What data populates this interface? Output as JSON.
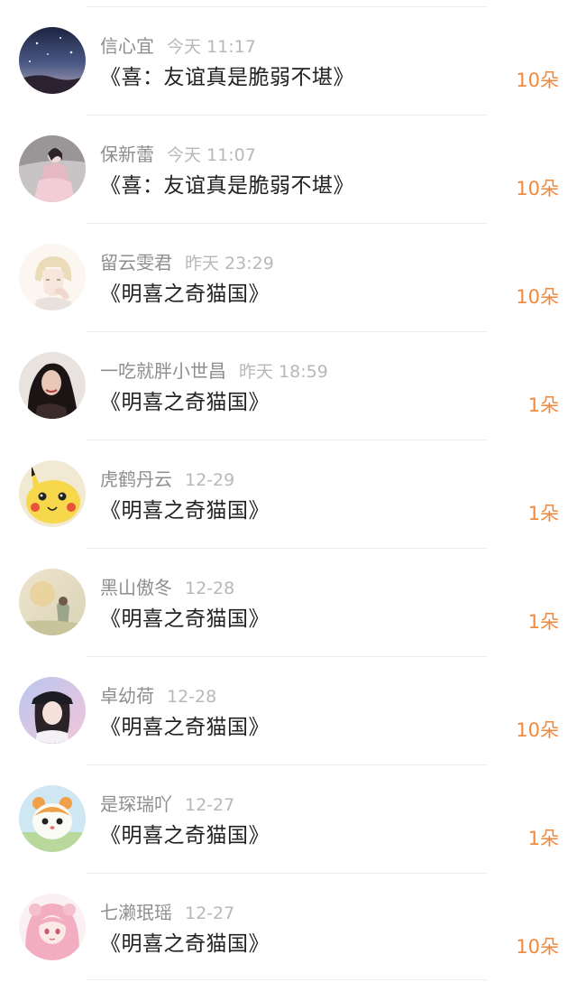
{
  "gifts": [
    {
      "name": "信心宜",
      "time": "今天 11:17",
      "title": "《喜：友谊真是脆弱不堪》",
      "count": "10朵",
      "avatar": "night-sky-avatar"
    },
    {
      "name": "保新蕾",
      "time": "今天 11:07",
      "title": "《喜：友谊真是脆弱不堪》",
      "count": "10朵",
      "avatar": "girl-pink-dress-avatar"
    },
    {
      "name": "留云雯君",
      "time": "昨天 23:29",
      "title": "《明喜之奇猫国》",
      "count": "10朵",
      "avatar": "anime-blond-boy-avatar"
    },
    {
      "name": "一吃就胖小世昌",
      "time": "昨天 18:59",
      "title": "《明喜之奇猫国》",
      "count": "1朵",
      "avatar": "dark-hair-woman-avatar"
    },
    {
      "name": "虎鹤丹云",
      "time": "12-29",
      "title": "《明喜之奇猫国》",
      "count": "1朵",
      "avatar": "pikachu-avatar"
    },
    {
      "name": "黑山傲冬",
      "time": "12-28",
      "title": "《明喜之奇猫国》",
      "count": "1朵",
      "avatar": "watercolor-scene-avatar"
    },
    {
      "name": "卓幼荷",
      "time": "12-28",
      "title": "《明喜之奇猫国》",
      "count": "10朵",
      "avatar": "girl-black-cap-avatar"
    },
    {
      "name": "是琛瑞吖",
      "time": "12-27",
      "title": "《明喜之奇猫国》",
      "count": "1朵",
      "avatar": "hamster-cartoon-avatar"
    },
    {
      "name": "七濑珉瑶",
      "time": "12-27",
      "title": "《明喜之奇猫国》",
      "count": "10朵",
      "avatar": "pink-hair-anime-girl-avatar"
    }
  ],
  "colors": {
    "count": "#f0893c",
    "name": "#8e8e8e",
    "time": "#b8b8b8",
    "title": "#222222",
    "divider": "#ececec"
  }
}
